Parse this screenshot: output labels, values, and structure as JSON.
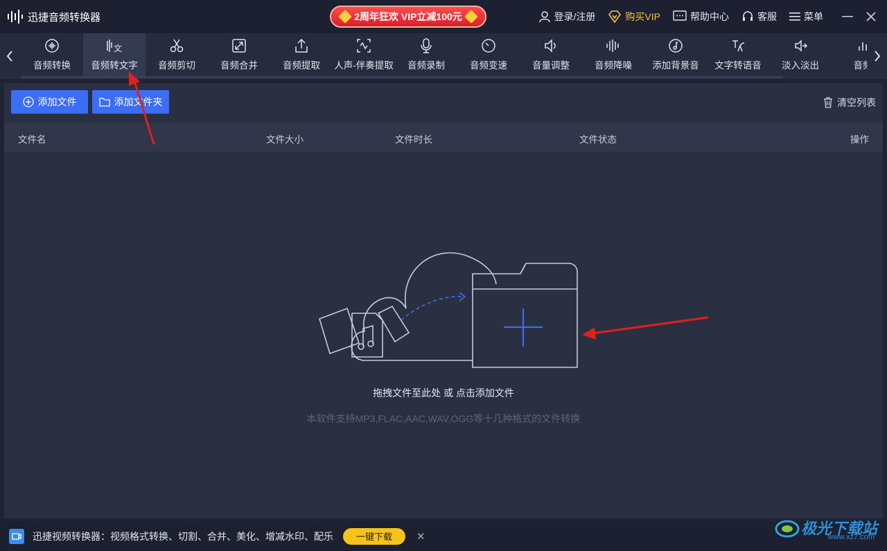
{
  "app": {
    "title": "迅捷音频转换器"
  },
  "promo": {
    "label": "2周年狂欢  VIP立减100元"
  },
  "titlebar": {
    "login": "登录/注册",
    "buy_vip": "购买VIP",
    "help": "帮助中心",
    "service": "客服",
    "menu": "菜单"
  },
  "tools": [
    {
      "label": "音频转换",
      "icon": "audio-convert-icon"
    },
    {
      "label": "音频转文字",
      "icon": "audio-to-text-icon"
    },
    {
      "label": "音频剪切",
      "icon": "scissors-icon"
    },
    {
      "label": "音频合并",
      "icon": "merge-icon"
    },
    {
      "label": "音频提取",
      "icon": "extract-icon"
    },
    {
      "label": "人声-伴奏提取",
      "icon": "vocal-extract-icon"
    },
    {
      "label": "音频录制",
      "icon": "microphone-icon"
    },
    {
      "label": "音频变速",
      "icon": "speed-icon"
    },
    {
      "label": "音量调整",
      "icon": "volume-icon"
    },
    {
      "label": "音频降噪",
      "icon": "denoise-icon"
    },
    {
      "label": "添加背景音",
      "icon": "background-music-icon"
    },
    {
      "label": "文字转语音",
      "icon": "text-to-speech-icon"
    },
    {
      "label": "淡入淡出",
      "icon": "fade-icon"
    },
    {
      "label": "音频",
      "icon": "bars-icon"
    }
  ],
  "actions": {
    "add_file": "添加文件",
    "add_folder": "添加文件夹",
    "clear_list": "清空列表"
  },
  "table": {
    "columns": [
      "文件名",
      "文件大小",
      "文件时长",
      "文件状态",
      "操作"
    ]
  },
  "dropzone": {
    "hint": "拖拽文件至此处 或 点击添加文件",
    "sub": "本软件支持MP3,FLAC,AAC,WAV,OGG等十几种格式的文件转换"
  },
  "bottom": {
    "promo_text": "迅捷视频转换器：视频格式转换、切割、合并、美化、增减水印、配乐",
    "download": "一键下载",
    "close": "✕"
  },
  "watermark": {
    "text": "极光下载站",
    "url": "www.xz7.com"
  },
  "colors": {
    "accent": "#3b6ef5",
    "bg": "#2a2f42",
    "promo": "#e02a33",
    "download": "#f6c31c",
    "arrow": "#e0201c"
  }
}
